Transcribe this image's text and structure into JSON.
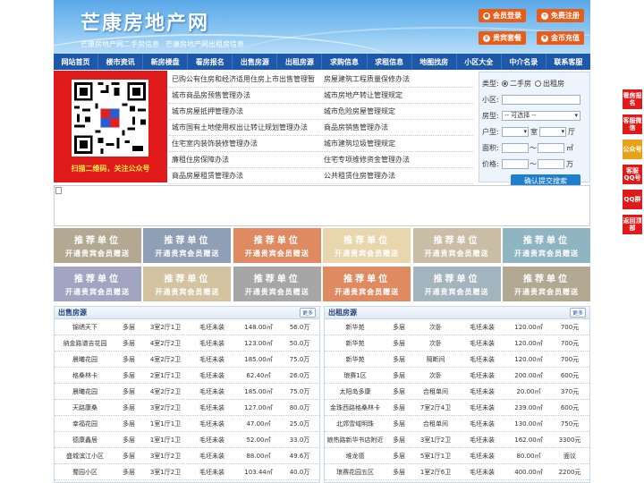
{
  "header": {
    "title": "芒康房地产网",
    "sub_links": [
      "芒康房地产网二手房信息",
      "芒康房地产网出租房信息"
    ],
    "buttons": [
      {
        "label": "会员登录",
        "icon": "user-icon"
      },
      {
        "label": "免费注册",
        "icon": "user-plus-icon"
      },
      {
        "label": "贵宾套餐",
        "icon": "crown-icon"
      },
      {
        "label": "金币充值",
        "icon": "coin-icon"
      }
    ]
  },
  "nav": [
    "网站首页",
    "楼市资讯",
    "新房楼盘",
    "看房报名",
    "出售房源",
    "出租房源",
    "求购信息",
    "求租信息",
    "地图找房",
    "小区大全",
    "中介名录",
    "联系客服"
  ],
  "qr": {
    "caption": "扫描二维码，关注公众号"
  },
  "links": [
    [
      "已购公有住房和经济适用住房上市出售管理暂",
      "房屋建筑工程质量保修办法"
    ],
    [
      "城市商品房预售管理办法",
      "城市房地产转让管理规定"
    ],
    [
      "城市房屋抵押管理办法",
      "城市危险房屋管理规定"
    ],
    [
      "城市国有土地使用权出让转让规划管理办法",
      "商品房销售管理办法"
    ],
    [
      "住宅室内装饰装修管理办法",
      "城市建筑垃圾管理规定"
    ],
    [
      "廉租住房保障办法",
      "住宅专项维修资金管理办法"
    ],
    [
      "商品房屋租赁管理办法",
      "公共租赁住房管理办法"
    ]
  ],
  "search": {
    "type_label": "类型:",
    "type_options": [
      "二手房",
      "出租房"
    ],
    "community_label": "小区:",
    "house_type_label": "房型:",
    "house_type_value": "-- 可选择 --",
    "layout_label": "户型:",
    "room_unit": "室",
    "hall_unit": "厅",
    "area_label": "面积:",
    "area_unit": "㎡",
    "price_label": "价格:",
    "price_unit": "万",
    "range_sep": "〜",
    "submit": "确认提交搜索"
  },
  "ads": {
    "line1": "推荐单位",
    "line2": "开通贵宾会员赠送",
    "colors": [
      "#b3a892",
      "#8f9fb5",
      "#e08a62",
      "#e9d6ad",
      "#c9bda6",
      "#8fb4c2",
      "#a1a5c2",
      "#d4c3a0",
      "#a6a6a6",
      "#e08a62",
      "#a2b4bd",
      "#b3a892"
    ]
  },
  "sale": {
    "title": "出售房源",
    "more": "更多",
    "rows": [
      [
        "锦绣天下",
        "多层",
        "3室2厅1卫",
        "毛坯未装",
        "148.00㎡",
        "56.0万"
      ],
      [
        "纳金路谱吉花园",
        "多层",
        "4室2厅2卫",
        "毛坯未装",
        "123.00㎡",
        "50.0万"
      ],
      [
        "晨曦花园",
        "多层",
        "4室2厅2卫",
        "毛坯未装",
        "185.00㎡",
        "75.0万"
      ],
      [
        "格桑林卡",
        "多层",
        "2室1厅1卫",
        "毛坯未装",
        "62.40㎡",
        "26.0万"
      ],
      [
        "晨曦花园",
        "多层",
        "4室2厅2卫",
        "毛坯未装",
        "185.00㎡",
        "75.0万"
      ],
      [
        "天路康桑",
        "多层",
        "3室2厅2卫",
        "毛坯未装",
        "127.00㎡",
        "80.0万"
      ],
      [
        "幸福花园",
        "多层",
        "1室1厅1卫",
        "毛坯未装",
        "47.00㎡",
        "25.0万"
      ],
      [
        "德康鑫居",
        "多层",
        "1室1厅1卫",
        "毛坯未装",
        "52.00㎡",
        "33.0万"
      ],
      [
        "盛城滨江小区",
        "多层",
        "3室1厅2卫",
        "毛坯未装",
        "88.00㎡",
        "49.6万"
      ],
      [
        "蜀园小区",
        "多层",
        "3室1厅2卫",
        "毛坯未装",
        "103.44㎡",
        "40.0万"
      ]
    ]
  },
  "rent": {
    "title": "出租房源",
    "more": "更多",
    "rows": [
      [
        "新华苑",
        "多层",
        "次卧",
        "毛坯未装",
        "120.00㎡",
        "700元"
      ],
      [
        "新华苑",
        "多层",
        "次卧",
        "毛坯未装",
        "120.00㎡",
        "700元"
      ],
      [
        "新华苑",
        "多层",
        "隔断间",
        "毛坯未装",
        "120.00㎡",
        "700元"
      ],
      [
        "琅赛1区",
        "多层",
        "次卧",
        "毛坯未装",
        "200.00㎡",
        "600元"
      ],
      [
        "太阳岛多康",
        "多层",
        "合租单间",
        "毛坯未装",
        "20.00㎡",
        "370元"
      ],
      [
        "金珠西路格桑林卡",
        "多层",
        "7室2厅4卫",
        "毛坯未装",
        "239.00㎡",
        "600元"
      ],
      [
        "北郊雪域明珠",
        "多层",
        "合租单间",
        "毛坯未装",
        "130.00㎡",
        "750元"
      ],
      [
        "娘热路新华书店附近",
        "多层",
        "3室1厅2卫",
        "毛坯未装",
        "162.00㎡",
        "3300元"
      ],
      [
        "堆龙德",
        "多层",
        "5室1厅1卫",
        "毛坯未装",
        "80.00㎡",
        "面议"
      ],
      [
        "琅赛花园五区",
        "多层",
        "1室2厅6卫",
        "毛坯未装",
        "400.00㎡",
        "2200元"
      ]
    ]
  },
  "side": [
    "看房报名",
    "客服微信",
    "公众号",
    "客服QQ号",
    "QQ群",
    "返回顶部"
  ]
}
